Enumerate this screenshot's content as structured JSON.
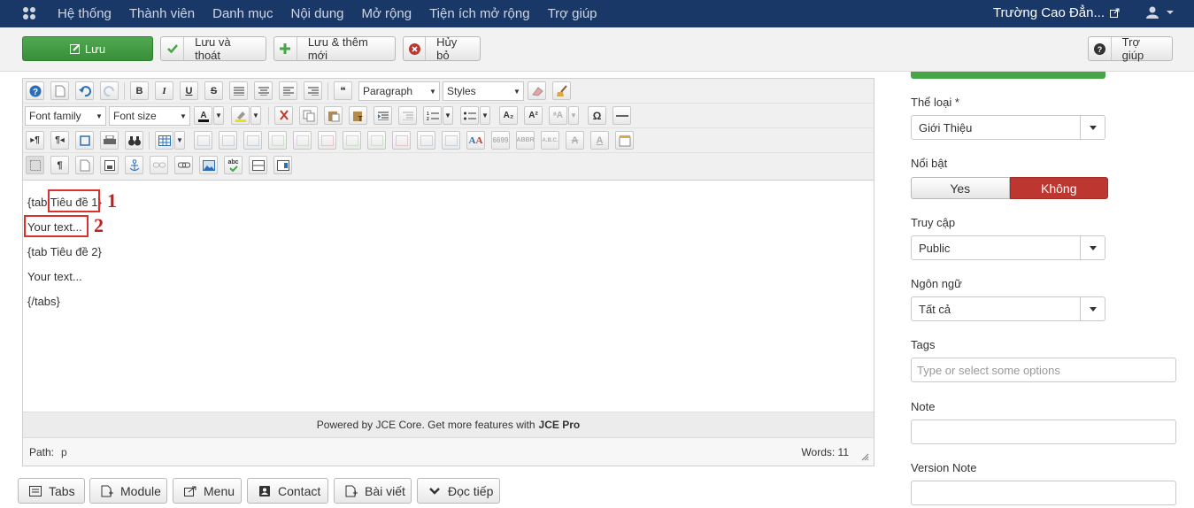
{
  "topnav": {
    "menu": [
      "Hệ thống",
      "Thành viên",
      "Danh mục",
      "Nội dung",
      "Mở rộng",
      "Tiện ích mở rộng",
      "Trợ giúp"
    ],
    "site_name": "Trường Cao Đẳn..."
  },
  "toolbar": {
    "save": "Lưu",
    "save_close": "Lưu và thoát",
    "save_new": "Lưu & thêm mới",
    "cancel": "Hủy bỏ",
    "help": "Trợ giúp"
  },
  "editor": {
    "format_select": "Paragraph",
    "styles_select": "Styles",
    "font_family": "Font family",
    "font_size": "Font size",
    "lines": [
      "{tab Tiêu đề 1}",
      "Your text...",
      "{tab Tiêu đề 2}",
      "Your text...",
      "{/tabs}"
    ],
    "annotations": [
      "1",
      "2"
    ],
    "powered_text": "Powered by JCE Core. Get more features with",
    "powered_link": "JCE Pro",
    "path_label": "Path:",
    "path_value": "p",
    "words": "Words: 11"
  },
  "plugins": [
    "Tabs",
    "Module",
    "Menu",
    "Contact",
    "Bài viết",
    "Đọc tiếp"
  ],
  "sidebar": {
    "category_label": "Thể loại *",
    "category_value": "Giới Thiệu",
    "featured_label": "Nổi bật",
    "featured_yes": "Yes",
    "featured_no": "Không",
    "access_label": "Truy cập",
    "access_value": "Public",
    "language_label": "Ngôn ngữ",
    "language_value": "Tất cả",
    "tags_label": "Tags",
    "tags_placeholder": "Type or select some options",
    "note_label": "Note",
    "note_value": "",
    "version_note_label": "Version Note",
    "version_note_value": ""
  },
  "colors": {
    "navbar": "#1a3867",
    "save_green": "#46a546",
    "active_red": "#bd362f",
    "annotation_red": "#d9312e"
  }
}
